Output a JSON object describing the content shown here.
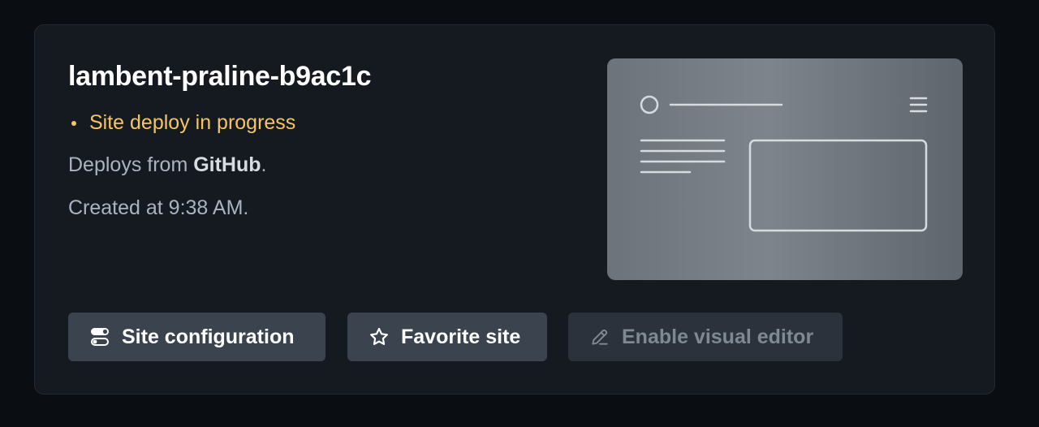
{
  "site": {
    "name": "lambent-praline-b9ac1c",
    "status": "Site deploy in progress",
    "deploys_prefix": "Deploys from ",
    "deploys_source": "GitHub",
    "deploys_suffix": ".",
    "created": "Created at 9:38 AM."
  },
  "actions": {
    "config_label": "Site configuration",
    "favorite_label": "Favorite site",
    "editor_label": "Enable visual editor"
  },
  "icons": {
    "config": "toggles-icon",
    "favorite": "star-icon",
    "editor": "pencil-icon"
  },
  "colors": {
    "status": "#f5c563",
    "button_bg": "#3a434e",
    "button_disabled_bg": "#2b323b"
  }
}
